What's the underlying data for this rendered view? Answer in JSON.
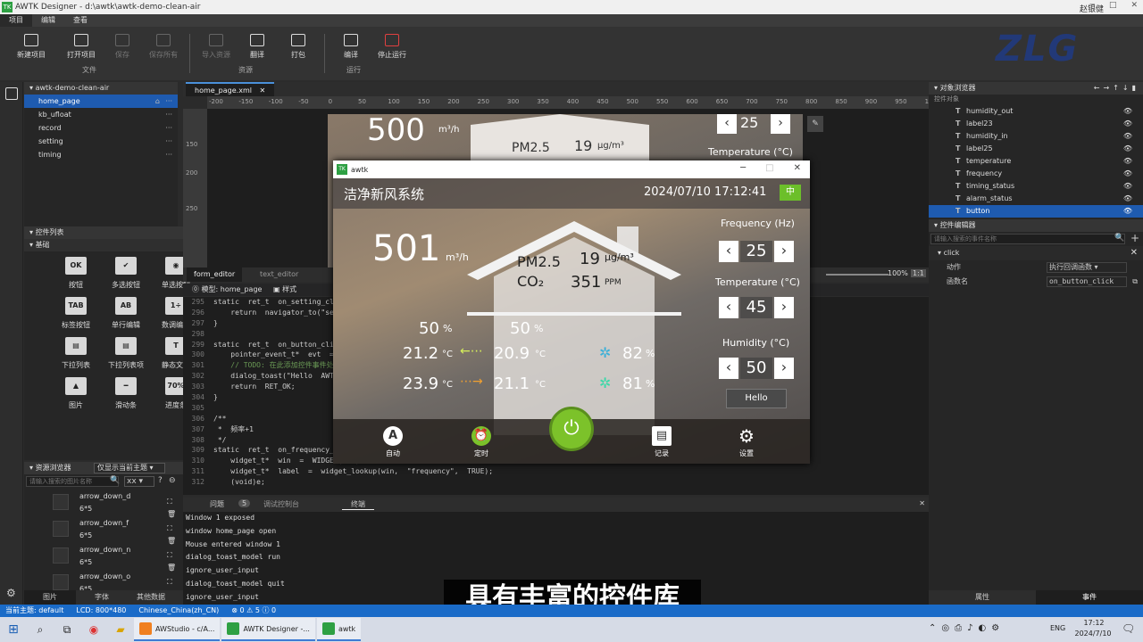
{
  "window": {
    "title": "AWTK Designer - d:\\awtk\\awtk-demo-clean-air",
    "user": "赵银健"
  },
  "menu": [
    "项目",
    "编辑",
    "查看"
  ],
  "toolbar": {
    "buttons": [
      "新建项目",
      "打开项目",
      "保存",
      "保存所有",
      "导入资源",
      "翻译",
      "打包",
      "编译",
      "停止运行"
    ],
    "groups": [
      "文件",
      "资源",
      "运行"
    ]
  },
  "project": {
    "name": "awtk-demo-clean-air",
    "items": [
      "home_page",
      "kb_ufloat",
      "record",
      "setting",
      "timing"
    ]
  },
  "widgets": {
    "header": "控件列表",
    "group": "基础",
    "items": [
      {
        "icon": "OK",
        "label": "按钮"
      },
      {
        "icon": "✔",
        "label": "多选按钮"
      },
      {
        "icon": "◉",
        "label": "单选按钮"
      },
      {
        "icon": "TAB",
        "label": "标签按钮"
      },
      {
        "icon": "AB",
        "label": "单行编辑"
      },
      {
        "icon": "1÷",
        "label": "数调编辑"
      },
      {
        "icon": "▤",
        "label": "下拉列表"
      },
      {
        "icon": "▤",
        "label": "下拉列表项"
      },
      {
        "icon": "T",
        "label": "静态文本"
      },
      {
        "icon": "▲",
        "label": "图片"
      },
      {
        "icon": "━",
        "label": "滑动条"
      },
      {
        "icon": "70%",
        "label": "进度条"
      }
    ]
  },
  "resources": {
    "header": "资源浏览器",
    "filter": "仅显示当前主题",
    "search_placeholder": "请输入搜索的图片名称",
    "scale": "xx",
    "items": [
      {
        "name": "arrow_down_d",
        "size": "6*5"
      },
      {
        "name": "arrow_down_f",
        "size": "6*5"
      },
      {
        "name": "arrow_down_n",
        "size": "6*5"
      },
      {
        "name": "arrow_down_o",
        "size": "6*5"
      }
    ],
    "tabs": [
      "图片",
      "字体",
      "其他数据"
    ]
  },
  "editor": {
    "file_tab": "home_page.xml",
    "ruler": [
      "-200",
      "-150",
      "-100",
      "-50",
      "0",
      "50",
      "100",
      "150",
      "200",
      "250",
      "300",
      "350",
      "400",
      "450",
      "500",
      "550",
      "600",
      "650",
      "700",
      "750",
      "800",
      "850",
      "900",
      "950",
      "1000"
    ],
    "vruler": [
      "150",
      "200",
      "250"
    ],
    "mode_tabs": [
      "form_editor",
      "text_editor"
    ],
    "zoom": "100%",
    "code_header": "模型: home_page",
    "code_header_style": "样式",
    "code": [
      {
        "n": "295",
        "t": "static  ret_t  on_setting_click(void"
      },
      {
        "n": "296",
        "t": "    return  navigator_to(\"setting\")"
      },
      {
        "n": "297",
        "t": "}"
      },
      {
        "n": "298",
        "t": ""
      },
      {
        "n": "299",
        "t": "static  ret_t  on_button_click(voi"
      },
      {
        "n": "300",
        "t": "    pointer_event_t*  evt  =  point"
      },
      {
        "n": "301",
        "t": "    // TODO: 在此添加控件事件处"
      },
      {
        "n": "302",
        "t": "    dialog_toast(\"Hello  AWTK\",  2"
      },
      {
        "n": "303",
        "t": "    return  RET_OK;"
      },
      {
        "n": "304",
        "t": "}"
      },
      {
        "n": "305",
        "t": ""
      },
      {
        "n": "306",
        "t": "/**"
      },
      {
        "n": "307",
        "t": " *  频率+1"
      },
      {
        "n": "308",
        "t": " */"
      },
      {
        "n": "309",
        "t": "static  ret_t  on_frequency_inc(vo"
      },
      {
        "n": "310",
        "t": "    widget_t*  win  =  WIDGET(ctx);"
      },
      {
        "n": "311",
        "t": "    widget_t*  label  =  widget_lookup(win,  \"frequency\",  TRUE);"
      },
      {
        "n": "312",
        "t": "    (void)e;"
      }
    ]
  },
  "console": {
    "tabs": [
      "问题",
      "5",
      "调试控制台",
      "终端"
    ],
    "lines": [
      "Window 1 exposed",
      "window home_page open",
      "Mouse entered window 1",
      "dialog_toast_model run",
      "ignore_user_input",
      "dialog_toast_model quit",
      "ignore_user_input"
    ]
  },
  "objects": {
    "header": "对象浏览器",
    "sub": "控件对象",
    "items": [
      "humidity_out",
      "label23",
      "humidity_in",
      "label25",
      "temperature",
      "frequency",
      "timing_status",
      "alarm_status",
      "button"
    ]
  },
  "control_editor": {
    "header": "控件编辑器",
    "search_placeholder": "请输入搜索的事件名称",
    "event": "click",
    "rows": [
      {
        "k": "动作",
        "v": "执行回调函数"
      },
      {
        "k": "函数名",
        "v": "on_button_click"
      }
    ],
    "tabs": [
      "属性",
      "事件"
    ]
  },
  "status": {
    "theme": "当前主题:  default",
    "lcd": "LCD:  800*480",
    "lang": "Chinese_China(zh_CN)",
    "counts": "⊗ 0  ⚠ 5  ⓘ 0"
  },
  "app": {
    "window_title": "awtk",
    "title": "洁净新风系统",
    "datetime": "2024/07/10  17:12:41",
    "lang_btn": "中",
    "flow": "501",
    "flow_unit": "m³/h",
    "pm_label": "PM2.5",
    "pm_value": "19",
    "pm_unit": "μg/m³",
    "co2_label": "CO₂",
    "co2_value": "351",
    "co2_unit": "PPM",
    "humid_out": "50",
    "humid_in": "50",
    "temp_out1": "21.2",
    "temp_in1": "20.9",
    "temp_out2": "23.9",
    "temp_in2": "21.1",
    "fan1": "82",
    "fan2": "81",
    "pct": "%",
    "deg": "°C",
    "freq_label": "Frequency (Hz)",
    "freq_value": "25",
    "temp_label": "Temperature  (°C)",
    "temp_value": "45",
    "hum_label": "Humidity  (°C)",
    "hum_value": "50",
    "hello": "Hello",
    "nav": [
      "自动",
      "定时",
      "记录",
      "设置"
    ],
    "bg_flow": "500",
    "bg_pm": "PM2.5",
    "bg_pm_value": "19",
    "bg_freq": "25",
    "bg_temp": "Temperature  (°C)"
  },
  "subtitle": "具有丰富的控件库",
  "taskbar": {
    "apps": [
      "AWStudio - c/A...",
      "AWTK Designer -...",
      "awtk"
    ],
    "lang": "ENG",
    "time": "17:12",
    "date": "2024/7/10"
  },
  "colors": {
    "accent": "#1e5bb0",
    "status": "#1a6bc8",
    "power": "#7cc22a"
  }
}
